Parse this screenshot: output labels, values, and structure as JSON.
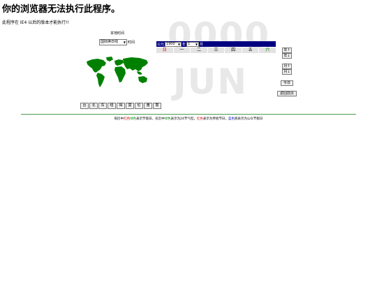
{
  "page": {
    "title": "你的浏览器无法执行此程序。",
    "warning": "此程序在 IE4 以后的版本才能执行!!"
  },
  "clock": {
    "local_time_label": "本地时间",
    "timezone_select": "国际换日线",
    "timezone_suffix": "时间"
  },
  "watermark": {
    "year": "0000",
    "month": "JUN"
  },
  "calendar": {
    "header_prefix": "公元",
    "year_select": "1900",
    "year_suffix": "年",
    "month_select": "1",
    "month_suffix": "月",
    "weekdays": [
      {
        "label": "日",
        "color": "#d00000"
      },
      {
        "label": "一",
        "color": "#000000"
      },
      {
        "label": "二",
        "color": "#000000"
      },
      {
        "label": "三",
        "color": "#000000"
      },
      {
        "label": "四",
        "color": "#000000"
      },
      {
        "label": "五",
        "color": "#000000"
      },
      {
        "label": "六",
        "color": "#008000"
      }
    ]
  },
  "nav": {
    "year_prev": "年↑",
    "year_next": "年↓",
    "month_prev": "月↑",
    "month_next": "月↓",
    "today": "今日",
    "back_home": "返回前页"
  },
  "city_buttons": [
    "台",
    "北",
    "东",
    "纽",
    "得",
    "莫",
    "伦",
    "雅",
    "香"
  ],
  "legend": [
    {
      "text": "阳历中",
      "color": "#000000"
    },
    {
      "text": "红色",
      "color": "#d00000"
    },
    {
      "text": "绿色",
      "color": "#008000"
    },
    {
      "text": "表示节假日，农历中",
      "color": "#000000"
    },
    {
      "text": "绿色",
      "color": "#008000"
    },
    {
      "text": "表示为24节气但，",
      "color": "#000000"
    },
    {
      "text": "红色",
      "color": "#d00000"
    },
    {
      "text": "表示为传统节日，",
      "color": "#000000"
    },
    {
      "text": "蓝色",
      "color": "#0000d0"
    },
    {
      "text": "则表示为公众节假日",
      "color": "#000000"
    }
  ],
  "colors": {
    "header_bg": "#000080",
    "map_land": "#008000",
    "divider": "#4a9a4a"
  }
}
